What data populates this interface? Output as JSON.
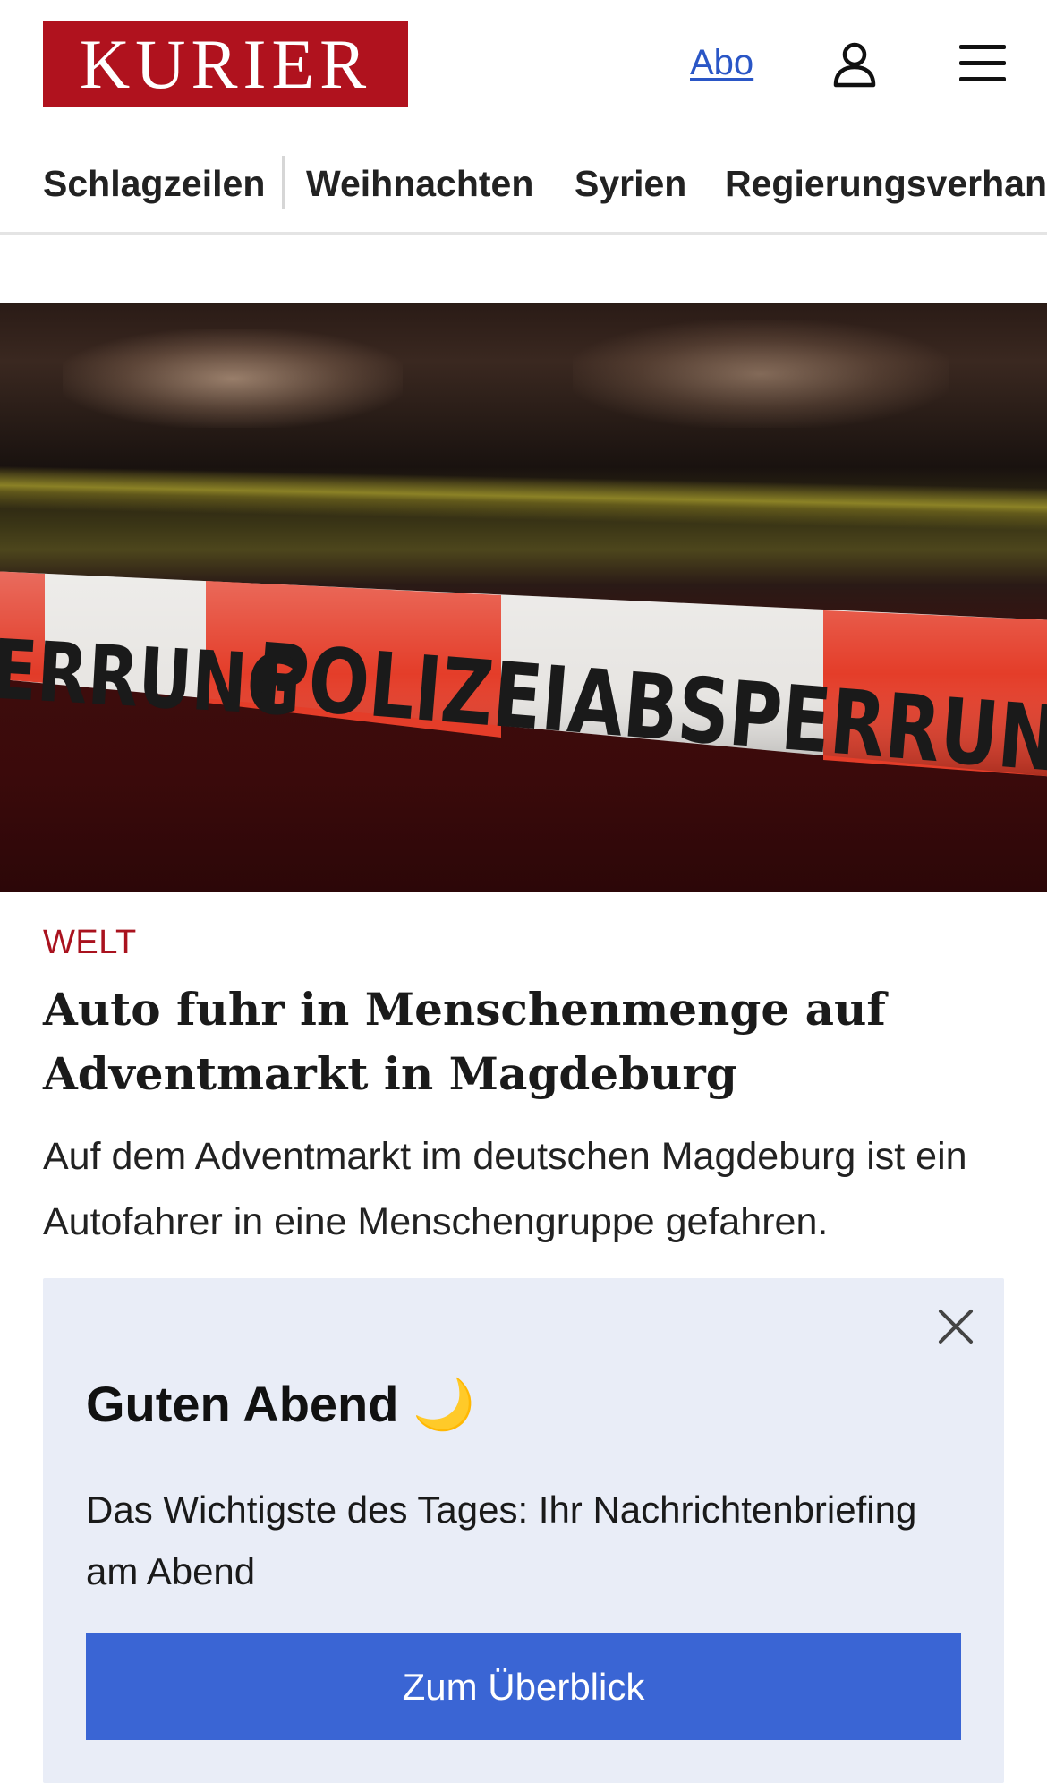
{
  "header": {
    "logo_text": "KURIER",
    "abo_label": "Abo",
    "user_icon": "user-icon",
    "menu_icon": "hamburger-menu-icon"
  },
  "nav": {
    "items": [
      {
        "label": "Schlagzeilen"
      },
      {
        "label": "Weihnachten"
      },
      {
        "label": "Syrien"
      },
      {
        "label": "Regierungsverhandlungen"
      }
    ]
  },
  "hero": {
    "tape_text_left": "ERRUNG",
    "tape_text_main": "POLIZEIABSPERRUNG"
  },
  "article": {
    "kicker": "WELT",
    "headline": "Auto fuhr in Menschenmenge auf Advent­markt in Magdeburg",
    "teaser": "Auf dem Adventmarkt im deutschen Magdeburg ist ein Autofahrer in eine Menschengruppe gefahren."
  },
  "overlay": {
    "title": "Guten Abend 🌙",
    "text": "Das Wichtigste des Tages: Ihr Nachrichtenbriefing am Abend",
    "button_label": "Zum Überblick",
    "close_icon": "close-icon"
  },
  "colors": {
    "brand_red": "#b0121e",
    "link_blue": "#2a56c6",
    "button_blue": "#3a65d4",
    "overlay_bg": "#e9edf7"
  }
}
